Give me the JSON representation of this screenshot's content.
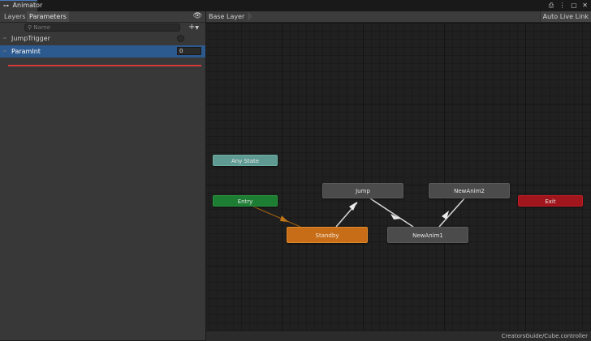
{
  "window": {
    "tab_title": "Animator",
    "tab_icon": "animator-icon",
    "controls": [
      "lock-icon",
      "menu-dots-icon",
      "maximize-icon",
      "close-icon"
    ]
  },
  "left_panel": {
    "tabs": [
      {
        "label": "Layers",
        "active": false
      },
      {
        "label": "Parameters",
        "active": true
      }
    ],
    "search_placeholder": "Name",
    "add_button": "+",
    "parameters": [
      {
        "name": "JumpTrigger",
        "type": "trigger",
        "value": ""
      },
      {
        "name": "ParamInt",
        "type": "int",
        "value": "0",
        "selected": true
      }
    ]
  },
  "graph": {
    "breadcrumb": "Base Layer",
    "auto_live_link": "Auto Live Link",
    "nodes": {
      "any_state": "Any State",
      "entry": "Entry",
      "exit": "Exit",
      "jump": "Jump",
      "newanim2": "NewAnim2",
      "standby": "Standby",
      "newanim1": "NewAnim1"
    },
    "colors": {
      "any_state": "#5e9a92",
      "entry": "#1d7d33",
      "exit": "#a0161c",
      "default_state": "#c86d17",
      "state": "#4b4b4b",
      "transition": "#d8d8d8",
      "entry_transition": "#a06010"
    }
  },
  "status": {
    "path": "CreatorsGuide/Cube.controller"
  }
}
